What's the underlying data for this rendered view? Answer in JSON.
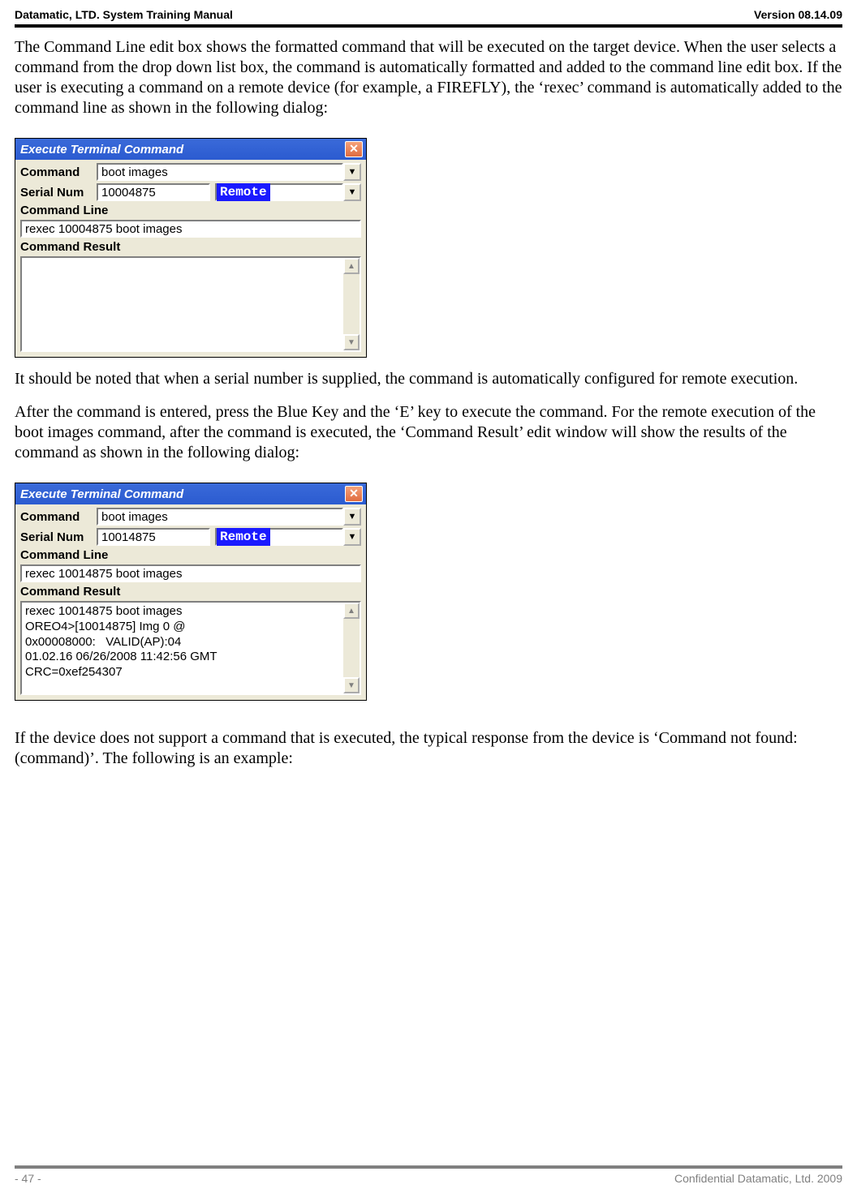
{
  "header": {
    "left": "Datamatic, LTD. System Training  Manual",
    "right": "Version 08.14.09"
  },
  "para1": "The Command Line edit box shows the formatted command that will be executed on the target device.  When the user selects a command from the drop down list box, the command is automatically formatted and added to the command line edit box.  If the user is executing a command on a remote device (for example, a FIREFLY), the ‘rexec’ command is automatically added to the command line as shown in the following dialog:",
  "para2": "It should be noted that when a serial number is supplied, the command is automatically configured for remote execution.",
  "para3": "After the command is entered, press the Blue Key and the ‘E’ key to execute the command.  For the remote execution of the boot images command, after the command is executed, the ‘Command Result’ edit window will show the results of the command as shown in the following dialog:",
  "para4": "If the device does not support a command that is executed, the typical response from the device is ‘Command not found: (command)’.  The following is an example:",
  "dialog1": {
    "title": "Execute Terminal Command",
    "labels": {
      "command": "Command",
      "serial": "Serial Num",
      "cmdline": "Command Line",
      "result": "Command Result"
    },
    "command_value": "boot images",
    "serial_value": "10004875",
    "remote_label": "Remote",
    "commandline_value": "rexec 10004875 boot images",
    "result_value": ""
  },
  "dialog2": {
    "title": "Execute Terminal Command",
    "labels": {
      "command": "Command",
      "serial": "Serial Num",
      "cmdline": "Command Line",
      "result": "Command Result"
    },
    "command_value": "boot images",
    "serial_value": "10014875",
    "remote_label": "Remote",
    "commandline_value": "rexec 10014875 boot images",
    "result_value": "rexec 10014875 boot images\nOREO4>[10014875] Img 0 @\n0x00008000:   VALID(AP):04\n01.02.16 06/26/2008 11:42:56 GMT\nCRC=0xef254307"
  },
  "footer": {
    "left": "- 47 -",
    "right": "Confidential Datamatic, Ltd. 2009"
  },
  "icons": {
    "close": "✕",
    "down": "▼",
    "up": "▲"
  }
}
